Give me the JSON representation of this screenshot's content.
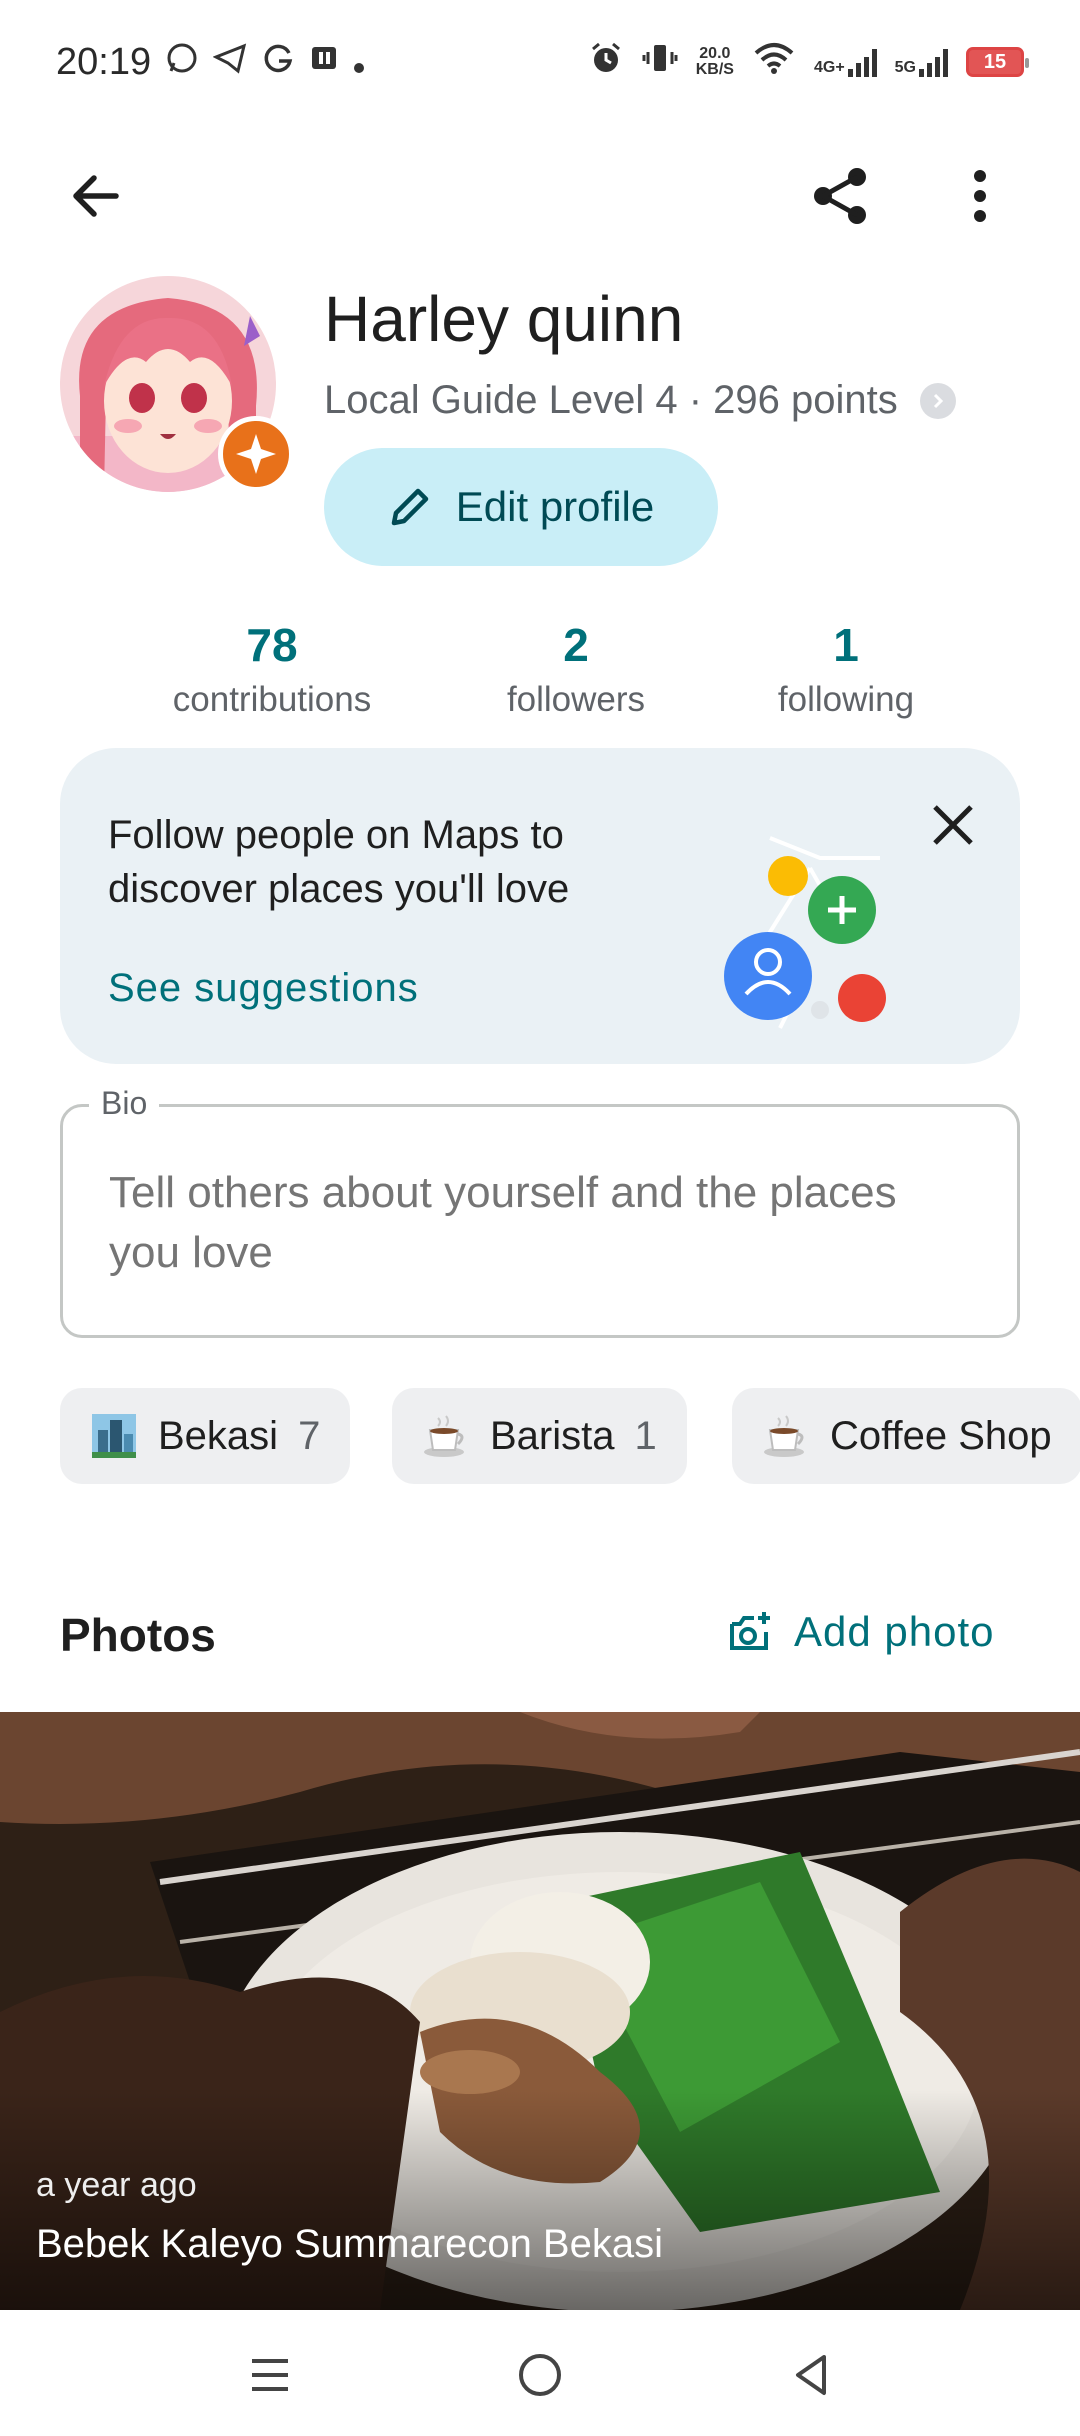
{
  "status_bar": {
    "time": "20:19",
    "speed_value": "20.0",
    "speed_unit": "KB/S",
    "net1": "4G+",
    "net2": "5G",
    "battery": "15"
  },
  "profile": {
    "name": "Harley quinn",
    "level": "Local Guide Level 4 · 296 points",
    "edit_label": "Edit profile"
  },
  "stats": [
    {
      "value": "78",
      "label": "contributions"
    },
    {
      "value": "2",
      "label": "followers"
    },
    {
      "value": "1",
      "label": "following"
    }
  ],
  "suggestion": {
    "text": "Follow people on Maps to discover places you'll love",
    "link": "See suggestions"
  },
  "bio": {
    "label": "Bio",
    "placeholder": "Tell others about yourself and the places you love"
  },
  "chips": [
    {
      "label": "Bekasi",
      "count": "7",
      "icon": "city-icon"
    },
    {
      "label": "Barista",
      "count": "1",
      "icon": "coffee-icon"
    },
    {
      "label": "Coffee Shop",
      "count": "",
      "icon": "coffee-icon"
    }
  ],
  "photos": {
    "title": "Photos",
    "add_label": "Add photo",
    "time": "a year ago",
    "place": "Bebek Kaleyo Summarecon Bekasi"
  },
  "colors": {
    "accent": "#00707a",
    "edit_bg": "#c9eef7",
    "card_bg": "#eaf1f5",
    "badge": "#e8711a"
  }
}
